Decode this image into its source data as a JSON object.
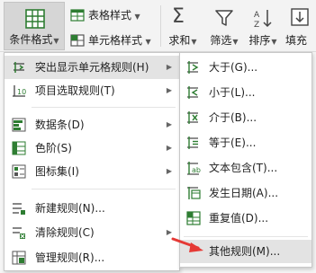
{
  "ribbon": {
    "conditional_format": "条件格式",
    "table_style": "表格样式",
    "cell_style": "单元格样式",
    "sum": "求和",
    "filter": "筛选",
    "sort": "排序",
    "fill": "填充"
  },
  "menu_main": {
    "items": [
      {
        "label": "突出显示单元格规则(H)",
        "icon": "highlight-rules-icon",
        "submenu": true
      },
      {
        "label": "项目选取规则(T)",
        "icon": "top-bottom-rules-icon",
        "submenu": true
      },
      {
        "label": "数据条(D)",
        "icon": "data-bars-icon",
        "submenu": true
      },
      {
        "label": "色阶(S)",
        "icon": "color-scales-icon",
        "submenu": true
      },
      {
        "label": "图标集(I)",
        "icon": "icon-sets-icon",
        "submenu": true
      },
      {
        "label": "新建规则(N)...",
        "icon": "new-rule-icon",
        "submenu": false
      },
      {
        "label": "清除规则(C)",
        "icon": "clear-rules-icon",
        "submenu": true
      },
      {
        "label": "管理规则(R)...",
        "icon": "manage-rules-icon",
        "submenu": false
      }
    ]
  },
  "menu_sub": {
    "items": [
      {
        "label": "大于(G)...",
        "icon": "greater-than-icon"
      },
      {
        "label": "小于(L)...",
        "icon": "less-than-icon"
      },
      {
        "label": "介于(B)...",
        "icon": "between-icon"
      },
      {
        "label": "等于(E)...",
        "icon": "equal-to-icon"
      },
      {
        "label": "文本包含(T)...",
        "icon": "text-contains-icon"
      },
      {
        "label": "发生日期(A)...",
        "icon": "date-occurring-icon"
      },
      {
        "label": "重复值(D)...",
        "icon": "duplicate-values-icon"
      },
      {
        "label": "其他规则(M)...",
        "icon": "more-rules-icon"
      }
    ]
  },
  "colors": {
    "accent": "#2e7d32",
    "arrow": "#e53935",
    "highlight": "#e3e3e3"
  }
}
